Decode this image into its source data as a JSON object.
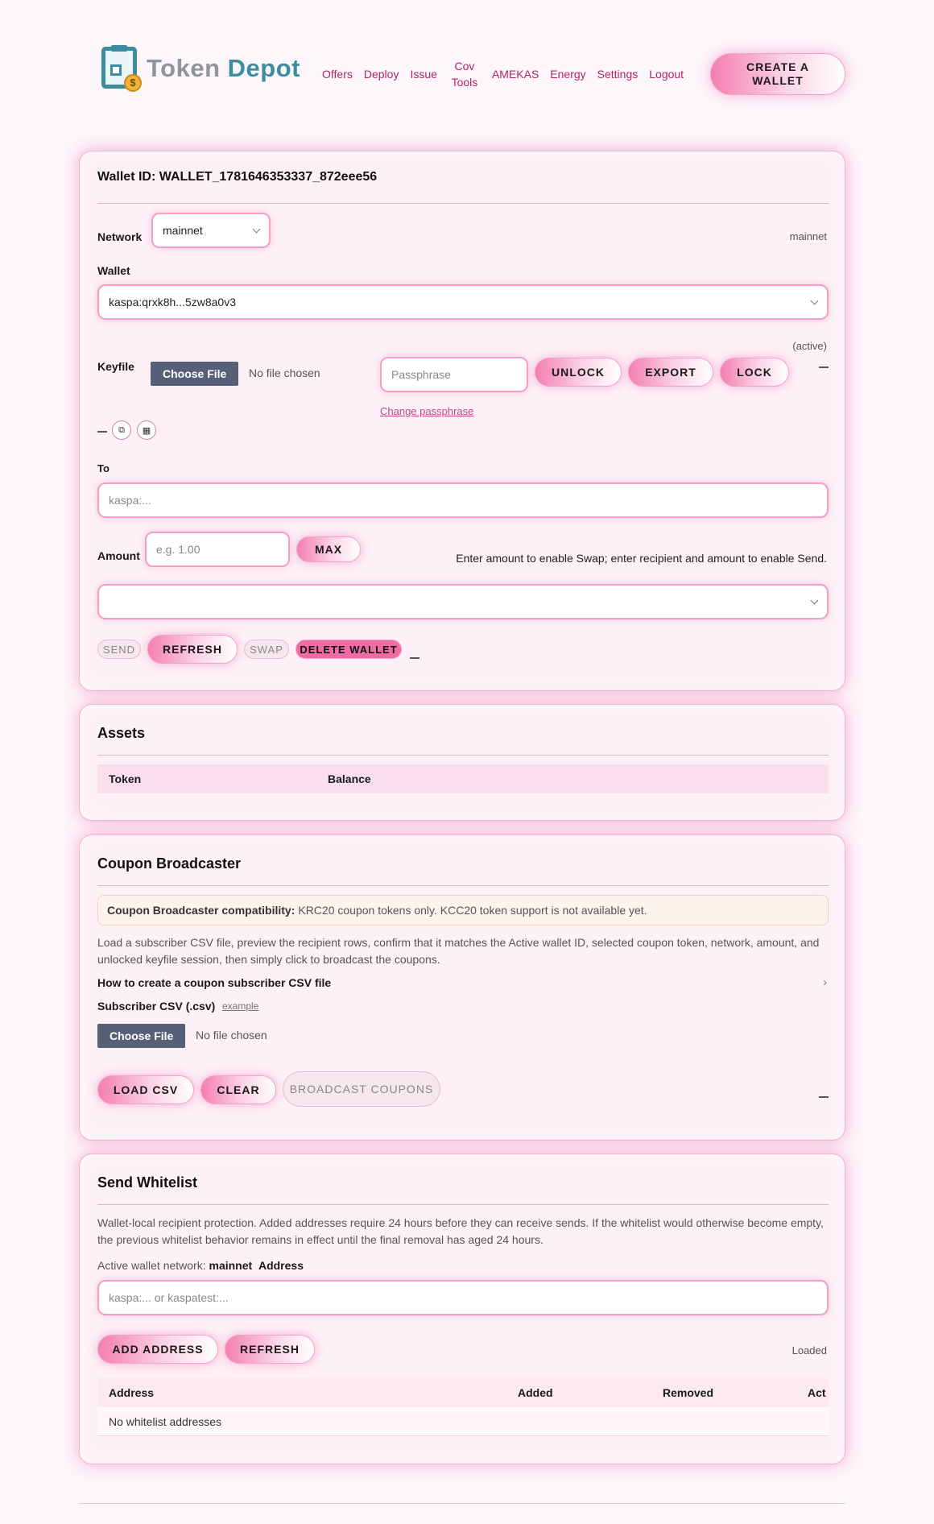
{
  "header": {
    "logo_text_a": "To",
    "logo_text_k": "k",
    "logo_text_b": "en",
    "logo_text_c": "Depot",
    "logo_coin": "$",
    "nav": [
      "Offers",
      "Deploy",
      "Issue",
      "Cov",
      "Tools",
      "AMEKAS",
      "Energy",
      "Settings",
      "Logout"
    ],
    "create_line1": "CREATE A",
    "create_line2": "WALLET"
  },
  "wallet": {
    "title": "Wallet ID: WALLET_1781646353337_872eee56",
    "network_label": "Network",
    "network_value": "mainnet",
    "network_status": "mainnet",
    "wallet_label": "Wallet",
    "wallet_value": "kaspa:qrxk8h...5zw8a0v3",
    "active_label": "(active)",
    "keyfile_label": "Keyfile",
    "choose_file": "Choose File",
    "no_file": "No file chosen",
    "passphrase_placeholder": "Passphrase",
    "unlock": "UNLOCK",
    "export": "EXPORT",
    "lock": "LOCK",
    "change_passphrase": "Change passphrase",
    "to_label": "To",
    "to_placeholder": "kaspa:...",
    "amount_label": "Amount",
    "amount_placeholder": "e.g. 1.00",
    "max": "MAX",
    "amount_hint": "Enter amount to enable Swap; enter recipient and amount to enable Send.",
    "send": "SEND",
    "refresh": "REFRESH",
    "swap": "SWAP",
    "delete": "DELETE WALLET"
  },
  "assets": {
    "title": "Assets",
    "columns": [
      "Token",
      "Balance"
    ]
  },
  "coupon": {
    "title": "Coupon Broadcaster",
    "notice_bold": "Coupon Broadcaster compatibility:",
    "notice_text": "KRC20 coupon tokens only. KCC20 token support is not available yet.",
    "description": "Load a subscriber CSV file, preview the recipient rows, confirm that it matches the Active wallet ID, selected coupon token, network, amount, and unlocked keyfile session, then simply click to broadcast the coupons.",
    "howto": "How to create a coupon subscriber CSV file",
    "csv_label": "Subscriber CSV (.csv)",
    "example": "example",
    "choose_file": "Choose File",
    "no_file": "No file chosen",
    "load_csv": "LOAD CSV",
    "clear": "CLEAR",
    "broadcast": "BROADCAST COUPONS"
  },
  "whitelist": {
    "title": "Send Whitelist",
    "description": "Wallet-local recipient protection. Added addresses require 24 hours before they can receive sends. If the whitelist would otherwise become empty, the previous whitelist behavior remains in effect until the final removal has aged 24 hours.",
    "network_prefix": "Active wallet network:",
    "network_value": "mainnet",
    "address_label": "Address",
    "address_placeholder": "kaspa:... or kaspatest:...",
    "add_address": "ADD ADDRESS",
    "refresh": "REFRESH",
    "status": "Loaded",
    "columns": [
      "Address",
      "Added",
      "Removed",
      "Act"
    ],
    "empty_row": "No whitelist addresses"
  }
}
